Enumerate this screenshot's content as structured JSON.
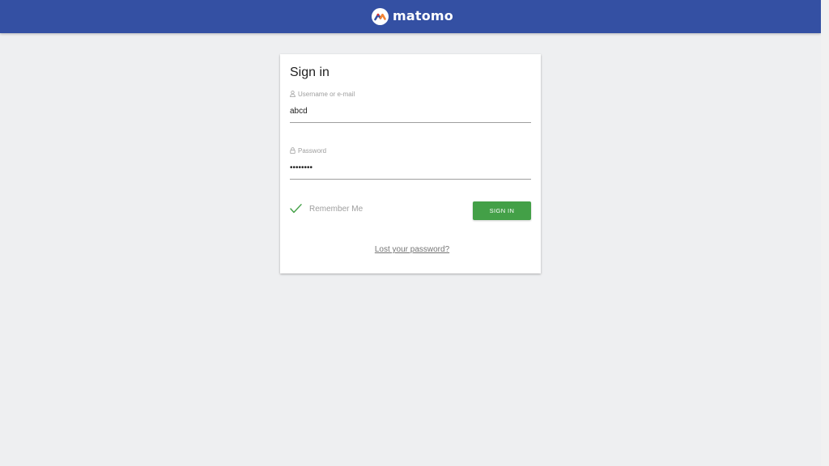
{
  "header": {
    "brand": "matomo",
    "background_color": "#3450a3",
    "logo_icon": "matomo-logo-icon"
  },
  "card": {
    "title": "Sign in"
  },
  "username": {
    "label": "Username or e-mail",
    "value": "abcd",
    "icon": "user-icon"
  },
  "password": {
    "label": "Password",
    "value": "********",
    "icon": "lock-icon"
  },
  "remember": {
    "label": "Remember Me",
    "checked": true,
    "icon": "checkmark-icon",
    "check_color": "#43a047"
  },
  "signin_button": {
    "label": "SIGN IN",
    "color": "#43a047"
  },
  "lost_password": {
    "label": "Lost your password?"
  }
}
